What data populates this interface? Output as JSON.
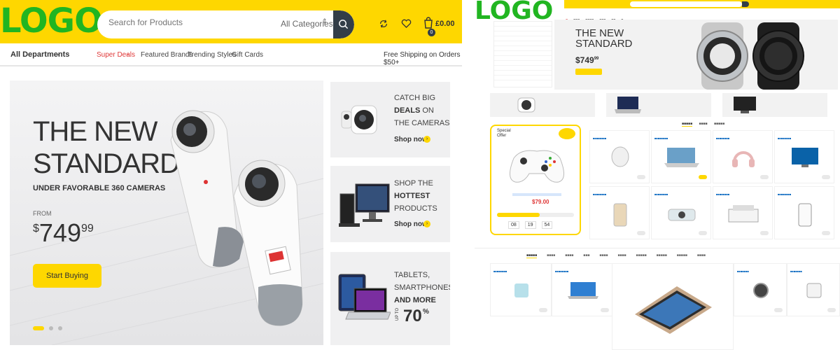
{
  "left": {
    "logo": "LOGO",
    "search": {
      "placeholder": "Search for Products",
      "category": "All Categories"
    },
    "icons": [
      "search-icon",
      "compare-icon",
      "heart-icon",
      "cart-icon"
    ],
    "cart": {
      "total": "£0.00",
      "count": "0"
    },
    "nav": {
      "departments": "All Departments",
      "links": [
        "Super Deals",
        "Featured Brands",
        "Trending Styles",
        "Gift Cards"
      ],
      "shipping": "Free Shipping on Orders $50+"
    },
    "hero": {
      "title_line1": "THE NEW",
      "title_line2": "STANDARD",
      "subtitle": "UNDER FAVORABLE 360 CAMERAS",
      "from": "FROM",
      "price_currency": "$",
      "price_main": "749",
      "price_cents": "99",
      "button": "Start Buying"
    },
    "promos": [
      {
        "line1": "CATCH BIG",
        "line2_bold": "DEALS",
        "line2_rest": " ON",
        "line3": "THE CAMERAS",
        "shop": "Shop now"
      },
      {
        "line1": "SHOP THE",
        "line2_bold": "HOTTEST",
        "line2_rest": "",
        "line3": "PRODUCTS",
        "shop": "Shop now"
      },
      {
        "line1": "TABLETS,",
        "line2": "SMARTPHONES",
        "line3_bold": "AND MORE",
        "upto": "UP TO",
        "pct": "70",
        "pct_sign": "%"
      }
    ]
  },
  "right": {
    "logo": "LOGO",
    "hero_title_1": "THE NEW",
    "hero_title_2": "STANDARD",
    "hero_price": "$749",
    "hero_price_cents": "99",
    "special_offer": "Special Offer",
    "special_price": "$79.00",
    "countdown": [
      "08",
      "19",
      "54"
    ]
  },
  "colors": {
    "brand_yellow": "#fed700",
    "logo_green": "#21b521",
    "dark": "#333e48",
    "hot_red": "#df3737"
  }
}
